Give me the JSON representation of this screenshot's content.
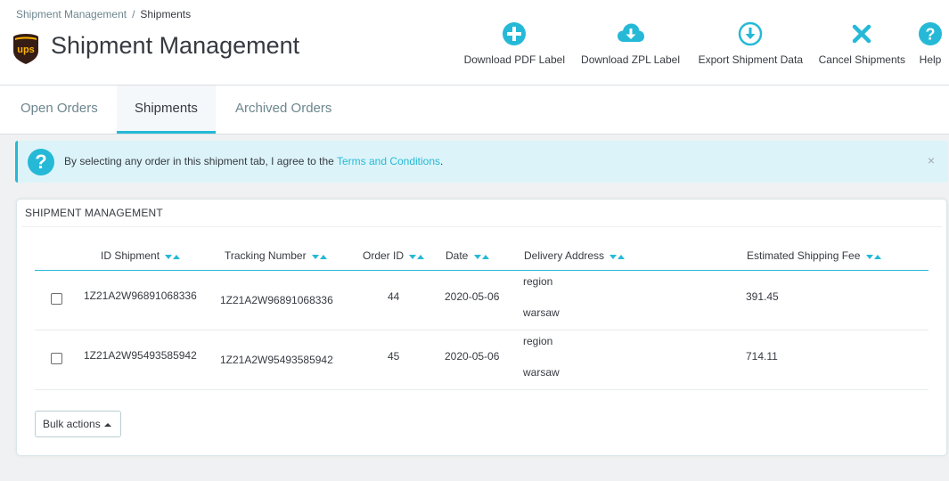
{
  "breadcrumb": {
    "parent": "Shipment Management",
    "separator": "/",
    "current": "Shipments"
  },
  "header": {
    "title": "Shipment Management",
    "logo_text": "ups"
  },
  "toolbar": {
    "download_pdf": "Download PDF Label",
    "download_zpl": "Download ZPL Label",
    "export_data": "Export Shipment Data",
    "cancel": "Cancel Shipments",
    "help": "Help"
  },
  "tabs": [
    {
      "label": "Open Orders"
    },
    {
      "label": "Shipments"
    },
    {
      "label": "Archived Orders"
    }
  ],
  "alert": {
    "icon": "?",
    "text": "By selecting any order in this shipment tab, I agree to the",
    "link": "Terms and Conditions",
    "suffix": ".",
    "close": "×"
  },
  "panel": {
    "heading": "SHIPMENT MANAGEMENT"
  },
  "table": {
    "headers": {
      "id": "ID Shipment",
      "tracking": "Tracking Number",
      "order": "Order ID",
      "date": "Date",
      "address": "Delivery Address",
      "fee": "Estimated Shipping Fee"
    },
    "rows": [
      {
        "id": "1Z21A2W96891068336",
        "tracking": "1Z21A2W96891068336",
        "order": "44",
        "date": "2020-05-06",
        "address_line1": "region",
        "address_line2": "warsaw",
        "fee": "391.45"
      },
      {
        "id": "1Z21A2W95493585942",
        "tracking": "1Z21A2W95493585942",
        "order": "45",
        "date": "2020-05-06",
        "address_line1": "region",
        "address_line2": "warsaw",
        "fee": "714.11"
      }
    ]
  },
  "bulk": {
    "label": "Bulk actions"
  },
  "colors": {
    "accent": "#25b9d7",
    "ups_brown": "#351c15",
    "ups_gold": "#ffb500"
  }
}
